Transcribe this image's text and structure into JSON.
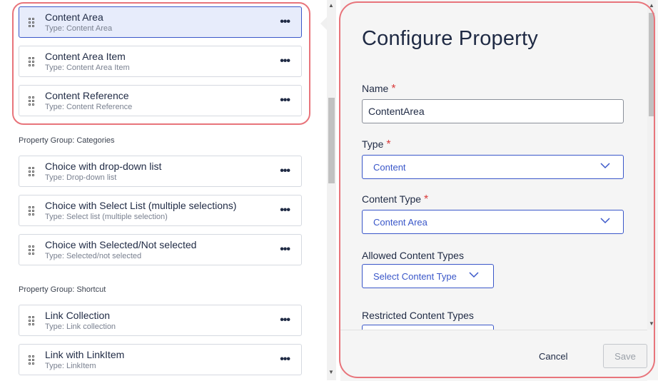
{
  "list": {
    "items_top": [
      {
        "title": "Content Area",
        "type": "Type: Content Area",
        "selected": true
      },
      {
        "title": "Content Area Item",
        "type": "Type: Content Area Item",
        "selected": false
      },
      {
        "title": "Content Reference",
        "type": "Type: Content Reference",
        "selected": false
      }
    ],
    "groups": [
      {
        "label": "Property Group: Categories",
        "items": [
          {
            "title": "Choice with drop-down list",
            "type": "Type: Drop-down list"
          },
          {
            "title": "Choice with Select List (multiple selections)",
            "type": "Type: Select list (multiple selection)"
          },
          {
            "title": "Choice with Selected/Not selected",
            "type": "Type: Selected/not selected"
          }
        ]
      },
      {
        "label": "Property Group: Shortcut",
        "items": [
          {
            "title": "Link Collection",
            "type": "Type: Link collection"
          },
          {
            "title": "Link with LinkItem",
            "type": "Type: LinkItem"
          }
        ]
      }
    ],
    "more_glyph": "•••"
  },
  "panel": {
    "title": "Configure Property",
    "name_label": "Name",
    "name_value": "ContentArea",
    "type_label": "Type",
    "type_value": "Content",
    "content_type_label": "Content Type",
    "content_type_value": "Content Area",
    "allowed_label": "Allowed Content Types",
    "allowed_value": "Select Content Type",
    "restricted_label": "Restricted Content Types",
    "required_marker": "*",
    "cancel_label": "Cancel",
    "save_label": "Save"
  },
  "colors": {
    "accent": "#3a57c9",
    "highlight": "#e8747b",
    "required": "#d93b3b"
  }
}
